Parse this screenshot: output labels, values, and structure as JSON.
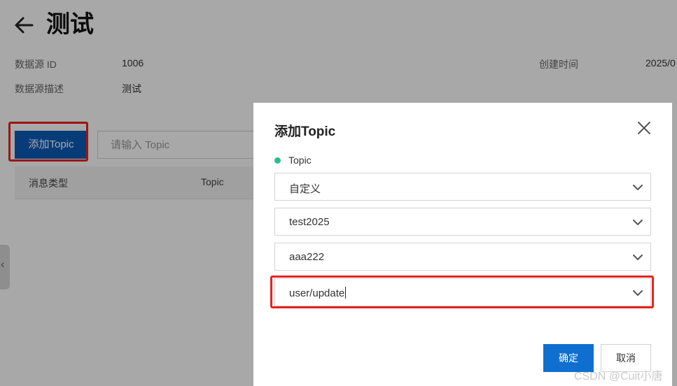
{
  "header": {
    "title": "测试"
  },
  "info": {
    "id_label": "数据源 ID",
    "id_value": "1006",
    "desc_label": "数据源描述",
    "desc_value": "测试",
    "created_label": "创建时间",
    "created_value": "2025/0"
  },
  "toolbar": {
    "add_topic_label": "添加Topic",
    "search_placeholder": "请输入 Topic"
  },
  "table": {
    "headers": [
      "消息类型",
      "Topic"
    ]
  },
  "dialog": {
    "title": "添加Topic",
    "field_label": "Topic",
    "selects": [
      {
        "value": "自定义"
      },
      {
        "value": "test2025"
      },
      {
        "value": "aaa222"
      },
      {
        "value": "user/update"
      }
    ],
    "confirm_label": "确定",
    "cancel_label": "取消"
  },
  "watermark": "CSDN @Cuit小唐",
  "colors": {
    "primary": "#0d5bb8",
    "confirm": "#0f6fcf",
    "highlight": "#e8231b",
    "required_dot": "#27c08b"
  },
  "icons": [
    "back-arrow-icon",
    "close-icon",
    "chevron-down-icon",
    "chevron-left-icon"
  ]
}
